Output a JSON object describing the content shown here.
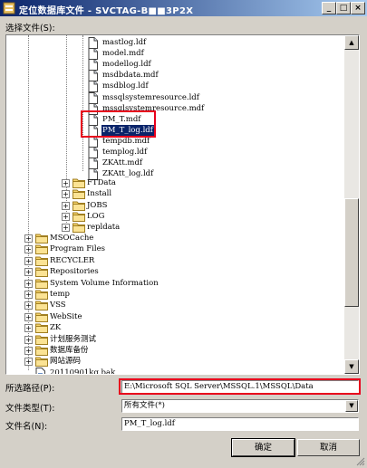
{
  "window": {
    "title": "定位数据库文件 - SVCTAG-B■■3P2X",
    "min_symbol": "_",
    "max_symbol": "□",
    "close_symbol": "×"
  },
  "select_label": "选择文件(S):",
  "tree": {
    "files_deep": [
      {
        "label": "mastlog.ldf",
        "selected": false
      },
      {
        "label": "model.mdf",
        "selected": false
      },
      {
        "label": "modellog.ldf",
        "selected": false
      },
      {
        "label": "msdbdata.mdf",
        "selected": false
      },
      {
        "label": "msdblog.ldf",
        "selected": false
      },
      {
        "label": "mssqlsystemresource.ldf",
        "selected": false
      },
      {
        "label": "mssqlsystemresource.mdf",
        "selected": false
      },
      {
        "label": "PM_T.mdf",
        "selected": false
      },
      {
        "label": "PM_T_log.ldf",
        "selected": true
      },
      {
        "label": "tempdb.mdf",
        "selected": false
      },
      {
        "label": "templog.ldf",
        "selected": false
      },
      {
        "label": "ZKAtt.mdf",
        "selected": false
      },
      {
        "label": "ZKAtt_log.ldf",
        "selected": false
      }
    ],
    "folders_mid": [
      "FTData",
      "Install",
      "JOBS",
      "LOG",
      "repldata"
    ],
    "folders_root": [
      "MSOCache",
      "Program Files",
      "RECYCLER",
      "Repositories",
      "System Volume Information",
      "temp",
      "VSS",
      "WebSite",
      "ZK",
      "计划服务测试",
      "数据库备份",
      "网站源码"
    ],
    "root_file": "20110901kq.bak"
  },
  "path_label": "所选路径(P):",
  "path_value": "E:\\Microsoft SQL Server\\MSSQL.1\\MSSQL\\Data",
  "type_label": "文件类型(T):",
  "type_value": "所有文件(*)",
  "name_label": "文件名(N):",
  "name_value": "PM_T_log.ldf",
  "ok_label": "确定",
  "cancel_label": "取消",
  "colors": {
    "highlight": "#e8001c",
    "selection": "#0a246a"
  }
}
